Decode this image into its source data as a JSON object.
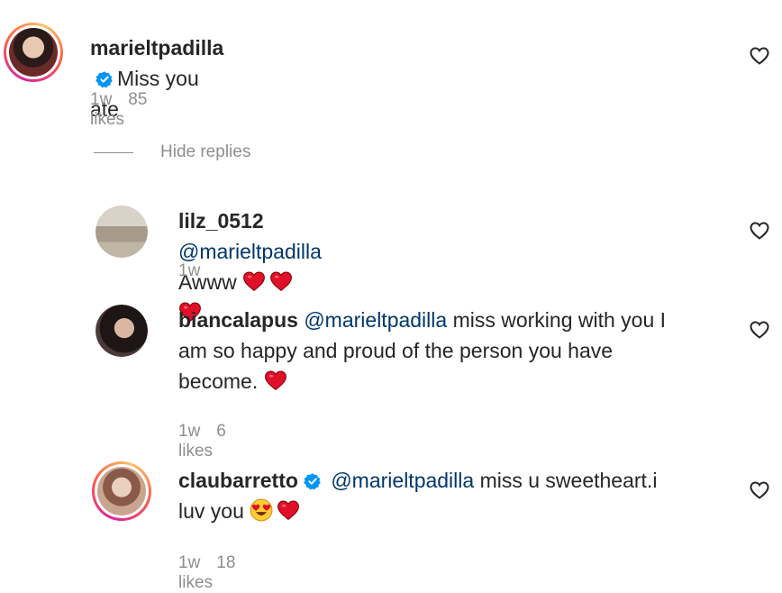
{
  "comments": [
    {
      "username": "marieltpadilla",
      "verified": true,
      "mention": "",
      "text": "Miss you ate",
      "time": "1w",
      "likes": "85 likes",
      "avatar_color": "#6b2a2a"
    },
    {
      "username": "lilz_0512",
      "verified": false,
      "mention": "@marieltpadilla",
      "text": "Awww",
      "emojis": [
        "red-heart",
        "red-heart",
        "red-heart"
      ],
      "time": "1w",
      "likes": "",
      "avatar_color": "#b9a89a"
    },
    {
      "username": "biancalapus",
      "verified": false,
      "mention": "@marieltpadilla",
      "text_line1": "miss working with you I",
      "text_line2": "am so happy and proud of the person you have",
      "text_line3": "become.",
      "emojis": [
        "red-heart"
      ],
      "time": "1w",
      "likes": "6 likes",
      "avatar_color": "#2b2424"
    },
    {
      "username": "claubarretto",
      "verified": true,
      "mention": "@marieltpadilla",
      "text_line1": "miss u sweetheart.i",
      "text_line2": "luv you",
      "emojis": [
        "heart-eyes",
        "red-heart"
      ],
      "time": "1w",
      "likes": "18 likes",
      "avatar_color": "#c9a48f"
    }
  ],
  "hide_replies_label": "Hide replies",
  "colors": {
    "text": "#262626",
    "mention": "#00376b",
    "secondary": "#8e8e8e",
    "verified": "#0095f6",
    "heart": "#e0102a"
  }
}
